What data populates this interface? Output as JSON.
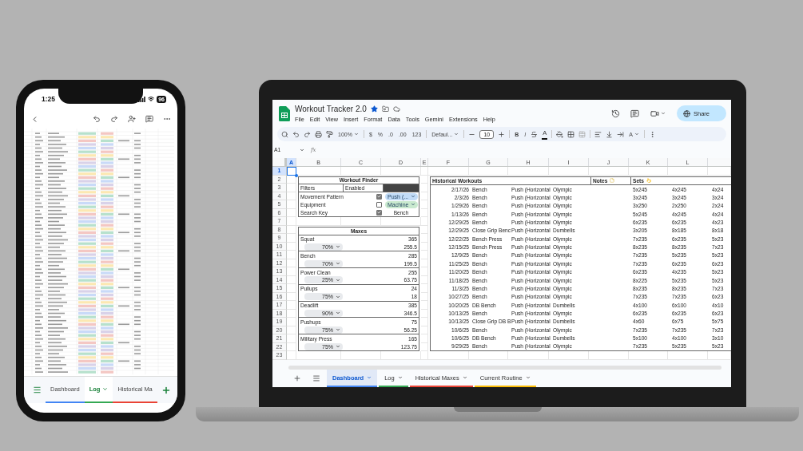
{
  "phone": {
    "time": "1:25",
    "battery": "96",
    "tabs": [
      {
        "label": "Dashboard",
        "selected": false,
        "color": "#4285f4"
      },
      {
        "label": "Log",
        "selected": true,
        "color": "#34a853"
      },
      {
        "label": "Historical Ma",
        "selected": false,
        "color": "#ea4335"
      }
    ]
  },
  "laptop": {
    "title": "Workout Tracker 2.0",
    "starred": true,
    "menu": [
      "File",
      "Edit",
      "View",
      "Insert",
      "Format",
      "Data",
      "Tools",
      "Gemini",
      "Extensions",
      "Help"
    ],
    "share": "Share",
    "toolbar": {
      "zoom": "100%",
      "currency": "$",
      "percent": "%",
      "decimal_less": ".0",
      "decimal_more": ".00",
      "number_format": "123",
      "font": "Defaul...",
      "font_size": "10",
      "bold": "B",
      "italic": "I",
      "text_color": "A",
      "rotation": "A"
    },
    "name_box": "A1",
    "formula_label": "fx",
    "columns": [
      {
        "label": "A",
        "selected": true
      },
      {
        "label": "B",
        "selected": false
      },
      {
        "label": "C",
        "selected": false
      },
      {
        "label": "D",
        "selected": false
      },
      {
        "label": "E",
        "selected": false
      },
      {
        "label": "F",
        "selected": false
      },
      {
        "label": "G",
        "selected": false
      },
      {
        "label": "H",
        "selected": false
      },
      {
        "label": "I",
        "selected": false
      },
      {
        "label": "J",
        "selected": false
      },
      {
        "label": "K",
        "selected": false
      },
      {
        "label": "L",
        "selected": false
      }
    ],
    "rows": [
      {
        "label": "1",
        "selected": true
      },
      {
        "label": "2",
        "selected": false
      },
      {
        "label": "3",
        "selected": false
      },
      {
        "label": "4",
        "selected": false
      },
      {
        "label": "5",
        "selected": false
      },
      {
        "label": "6",
        "selected": false
      },
      {
        "label": "7",
        "selected": false
      },
      {
        "label": "8",
        "selected": false
      },
      {
        "label": "9",
        "selected": false
      },
      {
        "label": "10",
        "selected": false
      },
      {
        "label": "11",
        "selected": false
      },
      {
        "label": "12",
        "selected": false
      },
      {
        "label": "13",
        "selected": false
      },
      {
        "label": "14",
        "selected": false
      },
      {
        "label": "15",
        "selected": false
      },
      {
        "label": "16",
        "selected": false
      },
      {
        "label": "17",
        "selected": false
      },
      {
        "label": "18",
        "selected": false
      },
      {
        "label": "19",
        "selected": false
      },
      {
        "label": "20",
        "selected": false
      },
      {
        "label": "21",
        "selected": false
      },
      {
        "label": "22",
        "selected": false
      },
      {
        "label": "23",
        "selected": false
      }
    ],
    "workout_finder": {
      "title": "Workout Finder",
      "filters_label": "Filters",
      "filters_value": "Enabled",
      "filters": [
        {
          "label": "Movement Pattern",
          "checked": true,
          "kind": "chip",
          "value": "Push (...",
          "color": "#c2dcf7"
        },
        {
          "label": "Equipment",
          "checked": false,
          "kind": "chip",
          "value": "Machine",
          "color": "#c9e9cf"
        },
        {
          "label": "Search Key",
          "checked": true,
          "kind": "text",
          "value": "Bench"
        }
      ]
    },
    "maxes": {
      "title": "Maxes",
      "lifts": [
        {
          "name": "Squat",
          "max": "365",
          "percent": "70%",
          "result": "255.5"
        },
        {
          "name": "Bench",
          "max": "285",
          "percent": "70%",
          "result": "199.5"
        },
        {
          "name": "Power Clean",
          "max": "255",
          "percent": "25%",
          "result": "63.75"
        },
        {
          "name": "Pullups",
          "max": "24",
          "percent": "75%",
          "result": "18"
        },
        {
          "name": "Deadlift",
          "max": "385",
          "percent": "90%",
          "result": "346.5"
        },
        {
          "name": "Pushups",
          "max": "75",
          "percent": "75%",
          "result": "56.25"
        },
        {
          "name": "Military Press",
          "max": "165",
          "percent": "75%",
          "result": "123.75"
        }
      ]
    },
    "history": {
      "title": "Historical Workouts",
      "notes_header": "Notes",
      "sets_header": "Sets",
      "rows": [
        {
          "date": "2/17/26",
          "exercise": "Bench",
          "movement": "Push (Horizontal",
          "equipment": "Olympic",
          "sets": [
            "5x245",
            "4x245",
            "4x24"
          ]
        },
        {
          "date": "2/3/26",
          "exercise": "Bench",
          "movement": "Push (Horizontal",
          "equipment": "Olympic",
          "sets": [
            "3x245",
            "3x245",
            "3x24"
          ]
        },
        {
          "date": "1/29/26",
          "exercise": "Bench",
          "movement": "Push (Horizontal",
          "equipment": "Olympic",
          "sets": [
            "3x250",
            "2x250",
            "2x24"
          ]
        },
        {
          "date": "1/13/26",
          "exercise": "Bench",
          "movement": "Push (Horizontal",
          "equipment": "Olympic",
          "sets": [
            "5x245",
            "4x245",
            "4x24"
          ]
        },
        {
          "date": "12/29/25",
          "exercise": "Bench",
          "movement": "Push (Horizontal",
          "equipment": "Olympic",
          "sets": [
            "6x235",
            "6x235",
            "4x23"
          ]
        },
        {
          "date": "12/29/25",
          "exercise": "Close Grip Benc",
          "movement": "Push (Horizontal",
          "equipment": "Dumbells",
          "sets": [
            "3x205",
            "8x185",
            "8x18"
          ]
        },
        {
          "date": "12/22/25",
          "exercise": "Bench Press",
          "movement": "Push (Horizontal",
          "equipment": "Olympic",
          "sets": [
            "7x235",
            "6x235",
            "5x23"
          ]
        },
        {
          "date": "12/15/25",
          "exercise": "Bench Press",
          "movement": "Push (Horizontal",
          "equipment": "Olympic",
          "sets": [
            "8x235",
            "8x235",
            "7x23"
          ]
        },
        {
          "date": "12/9/25",
          "exercise": "Bench",
          "movement": "Push (Horizontal",
          "equipment": "Olympic",
          "sets": [
            "7x235",
            "5x235",
            "5x23"
          ]
        },
        {
          "date": "11/25/25",
          "exercise": "Bench",
          "movement": "Push (Horizontal",
          "equipment": "Olympic",
          "sets": [
            "7x235",
            "6x235",
            "6x23"
          ]
        },
        {
          "date": "11/20/25",
          "exercise": "Bench",
          "movement": "Push (Horizontal",
          "equipment": "Olympic",
          "sets": [
            "6x235",
            "4x235",
            "5x23"
          ]
        },
        {
          "date": "11/18/25",
          "exercise": "Bench",
          "movement": "Push (Horizontal",
          "equipment": "Olympic",
          "sets": [
            "8x225",
            "5x235",
            "5x23"
          ]
        },
        {
          "date": "11/3/25",
          "exercise": "Bench",
          "movement": "Push (Horizontal",
          "equipment": "Olympic",
          "sets": [
            "8x235",
            "8x235",
            "7x23"
          ]
        },
        {
          "date": "10/27/25",
          "exercise": "Bench",
          "movement": "Push (Horizontal",
          "equipment": "Olympic",
          "sets": [
            "7x235",
            "7x235",
            "6x23"
          ]
        },
        {
          "date": "10/20/25",
          "exercise": "DB Bench",
          "movement": "Push (Horizontal",
          "equipment": "Dumbells",
          "sets": [
            "4x100",
            "6x100",
            "4x10"
          ]
        },
        {
          "date": "10/13/25",
          "exercise": "Bench",
          "movement": "Push (Horizontal",
          "equipment": "Olympic",
          "sets": [
            "6x235",
            "6x235",
            "6x23"
          ]
        },
        {
          "date": "10/13/25",
          "exercise": "Close Grip DB B",
          "movement": "Push (Horizontal",
          "equipment": "Dumbells",
          "sets": [
            "4x60",
            "6x75",
            "5x75"
          ]
        },
        {
          "date": "10/6/25",
          "exercise": "Bench",
          "movement": "Push (Horizontal",
          "equipment": "Olympic",
          "sets": [
            "7x235",
            "7x235",
            "7x23"
          ]
        },
        {
          "date": "10/6/25",
          "exercise": "DB Bench",
          "movement": "Push (Horizontal",
          "equipment": "Dumbells",
          "sets": [
            "5x100",
            "4x100",
            "3x10"
          ]
        },
        {
          "date": "9/29/25",
          "exercise": "Bench",
          "movement": "Push (Horizontal",
          "equipment": "Olympic",
          "sets": [
            "7x235",
            "5x235",
            "5x23"
          ]
        }
      ]
    },
    "sheet_tabs": [
      {
        "label": "Dashboard",
        "selected": true,
        "color": "#4285f4"
      },
      {
        "label": "Log",
        "selected": false,
        "color": "#34a853"
      },
      {
        "label": "Historical Maxes",
        "selected": false,
        "color": "#ea4335"
      },
      {
        "label": "Current Routine",
        "selected": false,
        "color": "#fbbc04"
      }
    ]
  }
}
